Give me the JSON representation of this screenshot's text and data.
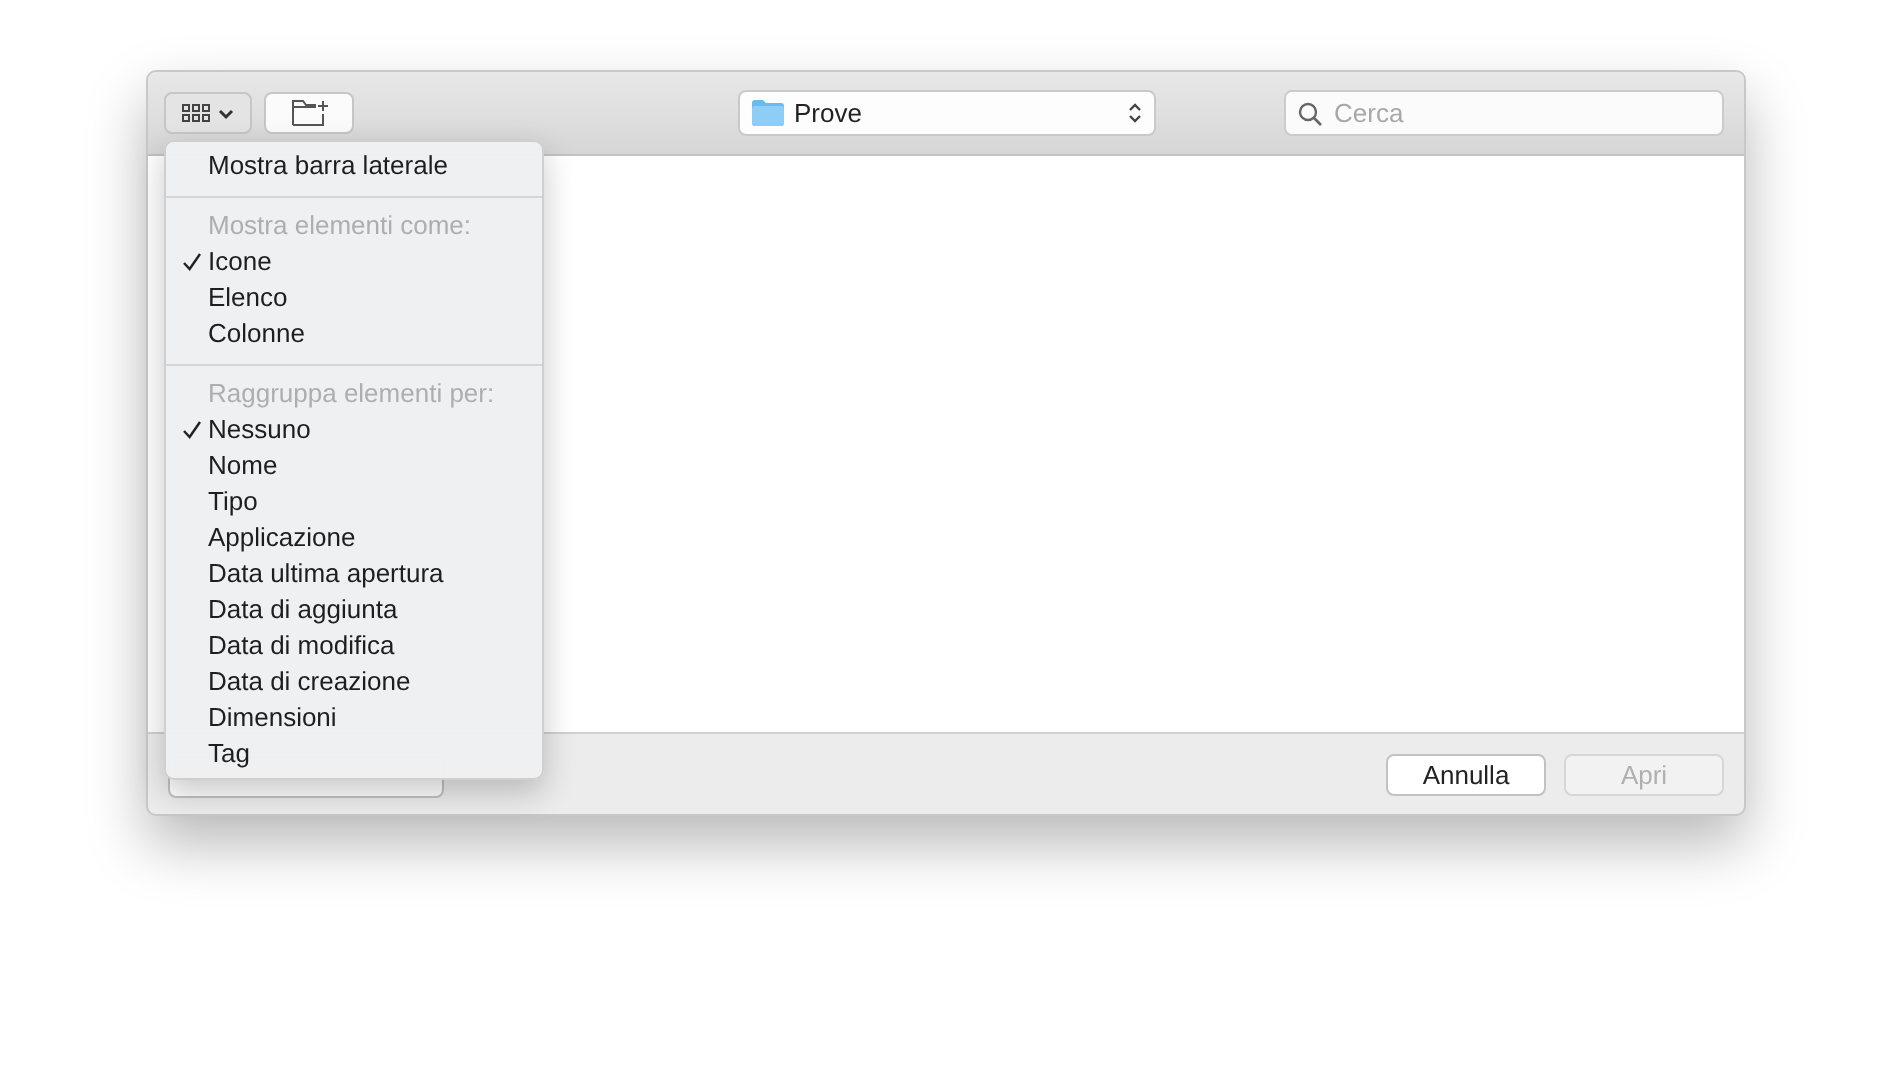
{
  "toolbar": {
    "view_button": {
      "expanded": true
    },
    "location": {
      "label": "Prove"
    },
    "search": {
      "placeholder": "Cerca"
    }
  },
  "view_menu": {
    "items": [
      {
        "kind": "item",
        "label": "Mostra barra laterale",
        "checked": false
      },
      {
        "kind": "separator"
      },
      {
        "kind": "header",
        "label": "Mostra elementi come:"
      },
      {
        "kind": "item",
        "label": "Icone",
        "checked": true
      },
      {
        "kind": "item",
        "label": "Elenco",
        "checked": false
      },
      {
        "kind": "item",
        "label": "Colonne",
        "checked": false
      },
      {
        "kind": "separator"
      },
      {
        "kind": "header",
        "label": "Raggruppa elementi per:"
      },
      {
        "kind": "item",
        "label": "Nessuno",
        "checked": true
      },
      {
        "kind": "item",
        "label": "Nome",
        "checked": false
      },
      {
        "kind": "item",
        "label": "Tipo",
        "checked": false
      },
      {
        "kind": "item",
        "label": "Applicazione",
        "checked": false
      },
      {
        "kind": "item",
        "label": "Data ultima apertura",
        "checked": false
      },
      {
        "kind": "item",
        "label": "Data di aggiunta",
        "checked": false
      },
      {
        "kind": "item",
        "label": "Data di modifica",
        "checked": false
      },
      {
        "kind": "item",
        "label": "Data di creazione",
        "checked": false
      },
      {
        "kind": "item",
        "label": "Dimensioni",
        "checked": false
      },
      {
        "kind": "item",
        "label": "Tag",
        "checked": false
      }
    ]
  },
  "footer": {
    "cancel_button": {
      "label": "Annulla",
      "disabled": false
    },
    "open_button": {
      "label": "Apri",
      "disabled": true
    }
  }
}
